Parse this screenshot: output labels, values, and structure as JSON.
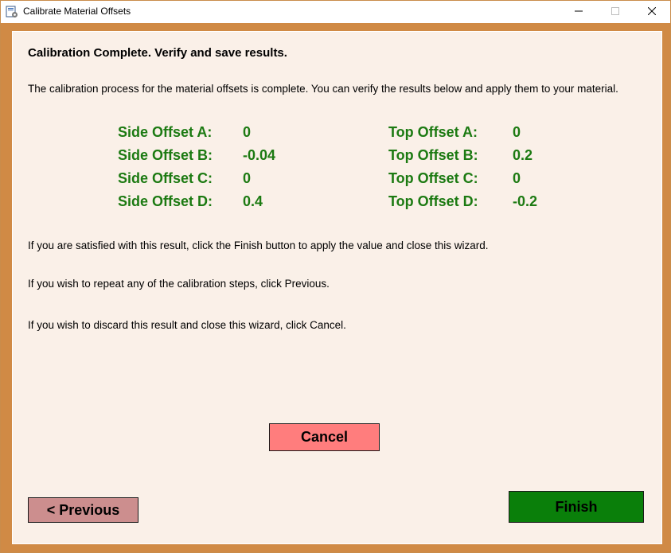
{
  "window": {
    "title": "Calibrate Material Offsets"
  },
  "content": {
    "heading": "Calibration Complete. Verify and save results.",
    "intro": "The calibration process for the material offsets is complete. You can verify the results below and apply them to your material.",
    "side_offsets": [
      {
        "label": "Side Offset A:",
        "value": "0"
      },
      {
        "label": "Side Offset B:",
        "value": "-0.04"
      },
      {
        "label": "Side Offset C:",
        "value": "0"
      },
      {
        "label": "Side Offset D:",
        "value": "0.4"
      }
    ],
    "top_offsets": [
      {
        "label": "Top Offset A:",
        "value": "0"
      },
      {
        "label": "Top Offset B:",
        "value": "0.2"
      },
      {
        "label": "Top Offset C:",
        "value": "0"
      },
      {
        "label": "Top Offset D:",
        "value": "-0.2"
      }
    ],
    "msg_finish": "If you are satisfied with this result, click the Finish button to apply the value and close this wizard.",
    "msg_previous": "If you wish to repeat any of the calibration steps, click Previous.",
    "msg_cancel": "If you wish to discard this result and close this wizard, click Cancel."
  },
  "buttons": {
    "cancel": "Cancel",
    "previous": "< Previous",
    "finish": "Finish"
  },
  "colors": {
    "offset_text": "#1c7a12",
    "frame": "#d08a45",
    "panel": "#faf0e8",
    "cancel_bg": "#ff7d7d",
    "previous_bg": "#cc8e8e",
    "finish_bg": "#0a7f0a"
  },
  "icons": {
    "app": "app-settings-icon",
    "minimize": "minimize-icon",
    "maximize": "maximize-icon",
    "close": "close-icon"
  }
}
